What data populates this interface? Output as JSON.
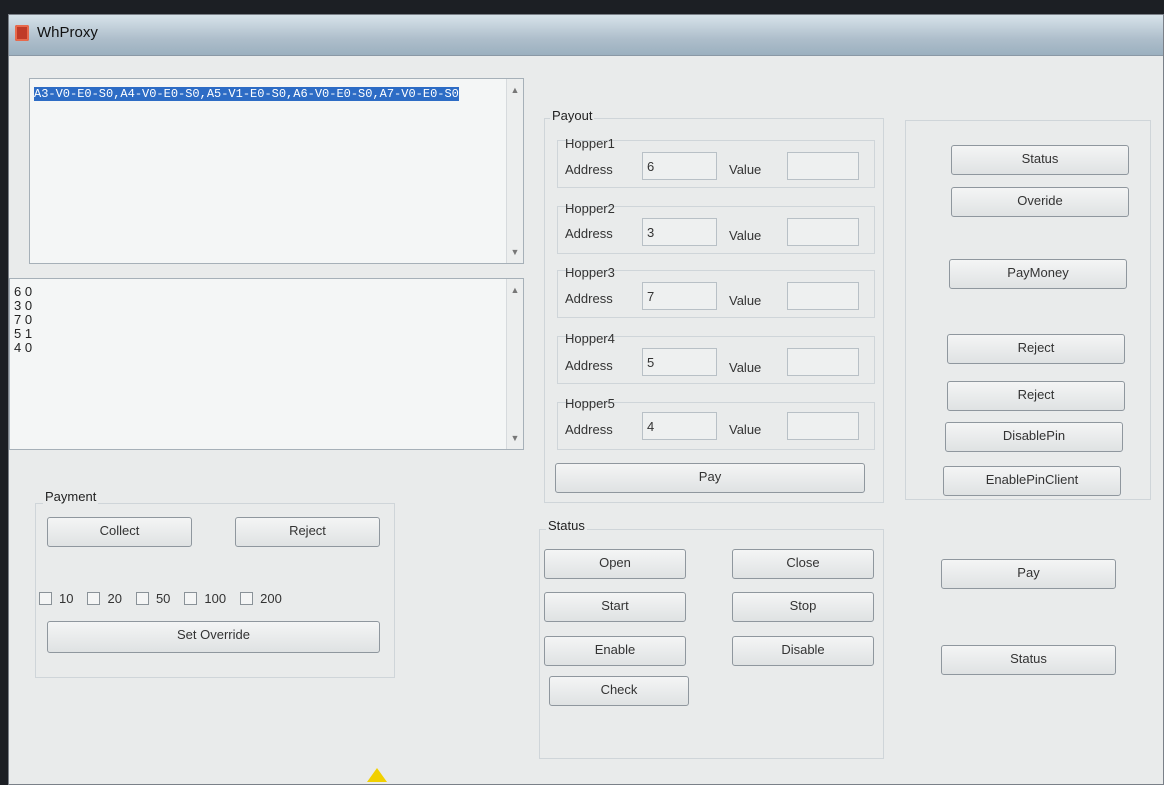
{
  "window": {
    "title": "WhProxy"
  },
  "log": {
    "selected_text": "A3-V0-E0-S0,A4-V0-E0-S0,A5-V1-E0-S0,A6-V0-E0-S0,A7-V0-E0-S0"
  },
  "results": {
    "lines": [
      "6 0",
      "3 0",
      "7 0",
      "5 1",
      "4 0"
    ]
  },
  "payment": {
    "label": "Payment",
    "collect_label": "Collect",
    "reject_label": "Reject",
    "denominations": [
      "10",
      "20",
      "50",
      "100",
      "200"
    ],
    "set_override_label": "Set Override"
  },
  "payout": {
    "label": "Payout",
    "address_label": "Address",
    "value_label": "Value",
    "hoppers": [
      {
        "name": "Hopper1",
        "address": "6",
        "value": ""
      },
      {
        "name": "Hopper2",
        "address": "3",
        "value": ""
      },
      {
        "name": "Hopper3",
        "address": "7",
        "value": ""
      },
      {
        "name": "Hopper4",
        "address": "5",
        "value": ""
      },
      {
        "name": "Hopper5",
        "address": "4",
        "value": ""
      }
    ],
    "pay_label": "Pay"
  },
  "status_group": {
    "label": "Status",
    "open_label": "Open",
    "close_label": "Close",
    "start_label": "Start",
    "stop_label": "Stop",
    "enable_label": "Enable",
    "disable_label": "Disable",
    "check_label": "Check"
  },
  "right_panel": {
    "status_label": "Status",
    "override_label": "Overide",
    "paymoney_label": "PayMoney",
    "reject1_label": "Reject",
    "reject2_label": "Reject",
    "disablepin_label": "DisablePin",
    "enablepinclient_label": "EnablePinClient",
    "pay_label": "Pay",
    "status2_label": "Status"
  },
  "colors": {
    "selection": "#2d6cc5",
    "title_icon": "#c03b28"
  }
}
